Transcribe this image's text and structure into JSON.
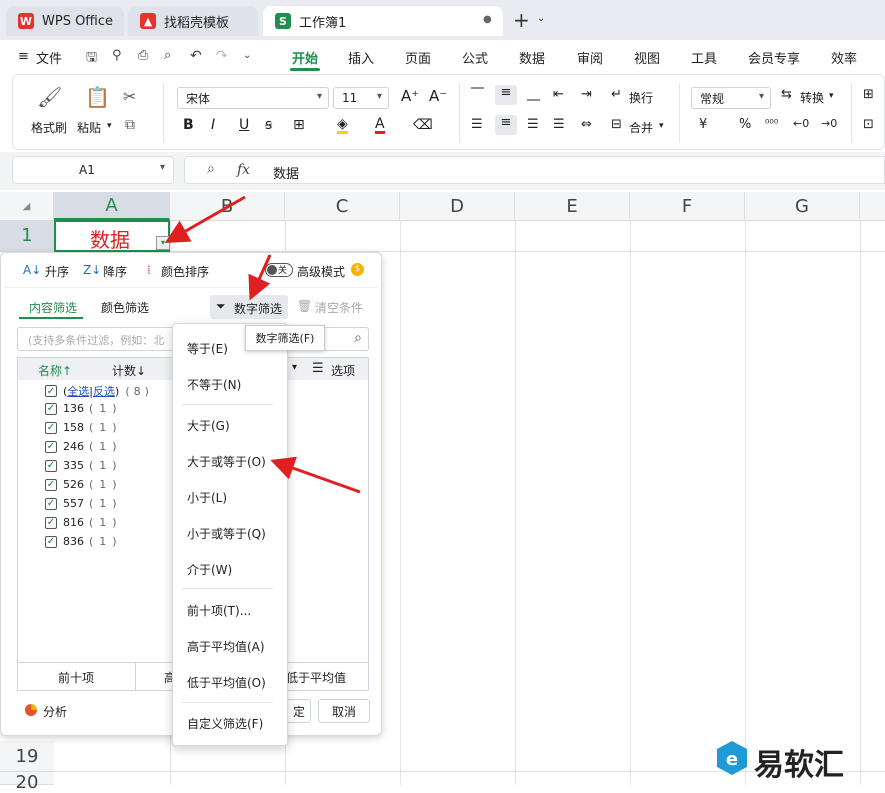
{
  "tabs": [
    {
      "label": "WPS Office",
      "icon": "wps-logo-icon"
    },
    {
      "label": "找稻壳模板",
      "icon": "docer-icon"
    },
    {
      "label": "工作簿1",
      "icon": "spreadsheet-s-icon",
      "icon_letter": "S"
    }
  ],
  "menu": {
    "file": "文件",
    "items": [
      "开始",
      "插入",
      "页面",
      "公式",
      "数据",
      "审阅",
      "视图",
      "工具",
      "会员专享",
      "效率"
    ]
  },
  "ribbon": {
    "format_painter": "格式刷",
    "paste": "粘贴",
    "font_name": "宋体",
    "font_size": "11",
    "wrap": "换行",
    "merge": "合并",
    "number_format": "常规",
    "convert": "转换",
    "currency_symbol": "¥",
    "percent_symbol": "%"
  },
  "formula_bar": {
    "cell_ref": "A1",
    "fx": "fx",
    "content": "数据"
  },
  "grid": {
    "columns": [
      "A",
      "B",
      "C",
      "D",
      "E",
      "F",
      "G"
    ],
    "row1": "1",
    "row19": "19",
    "row20": "20",
    "a1_value": "数据"
  },
  "filter_panel": {
    "sort_asc": "升序",
    "sort_desc": "降序",
    "color_sort": "颜色排序",
    "advanced_toggle": "关",
    "advanced_mode": "高级模式",
    "tab_content": "内容筛选",
    "tab_color": "颜色筛选",
    "number_filter": "数字筛选",
    "clear": "清空条件",
    "search_placeholder": "(支持多条件过滤，例如：北",
    "col_name": "名称↑",
    "col_count": "计数↓",
    "options": "选项",
    "select_all": "全选",
    "invert": "反选",
    "total": "8",
    "items": [
      {
        "value": "136",
        "count": "1"
      },
      {
        "value": "158",
        "count": "1"
      },
      {
        "value": "246",
        "count": "1"
      },
      {
        "value": "335",
        "count": "1"
      },
      {
        "value": "526",
        "count": "1"
      },
      {
        "value": "557",
        "count": "1"
      },
      {
        "value": "816",
        "count": "1"
      },
      {
        "value": "836",
        "count": "1"
      }
    ],
    "bottom_top10": "前十项",
    "bottom_above": "高",
    "bottom_below": "低于平均值",
    "analysis": "分析",
    "ok": "定",
    "cancel": "取消"
  },
  "number_filter_menu": {
    "items": [
      "等于(E)",
      "不等于(N)",
      "大于(G)",
      "大于或等于(O)",
      "小于(L)",
      "小于或等于(Q)",
      "介于(W)",
      "前十项(T)...",
      "高于平均值(A)",
      "低于平均值(O)",
      "自定义筛选(F)"
    ]
  },
  "tooltip": "数字筛选(F)",
  "watermark": "易软汇",
  "colors": {
    "accent_green": "#1f8f4e",
    "annotation_red": "#e02020",
    "cell_text_red": "#e02020"
  }
}
